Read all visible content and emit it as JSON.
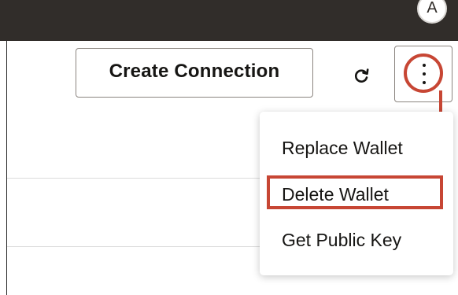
{
  "header": {
    "avatar_initial": "A"
  },
  "toolbar": {
    "create_connection_label": "Create Connection",
    "refresh_icon": "refresh-icon",
    "more_icon": "vertical-ellipsis-icon"
  },
  "menu": {
    "items": [
      {
        "label": "Replace Wallet"
      },
      {
        "label": "Delete Wallet"
      },
      {
        "label": "Get Public Key"
      }
    ]
  },
  "annotation": {
    "highlight_color": "#c74634"
  },
  "colors": {
    "topbar": "#312d2a",
    "text": "#161513",
    "button_border": "#8b8580"
  }
}
